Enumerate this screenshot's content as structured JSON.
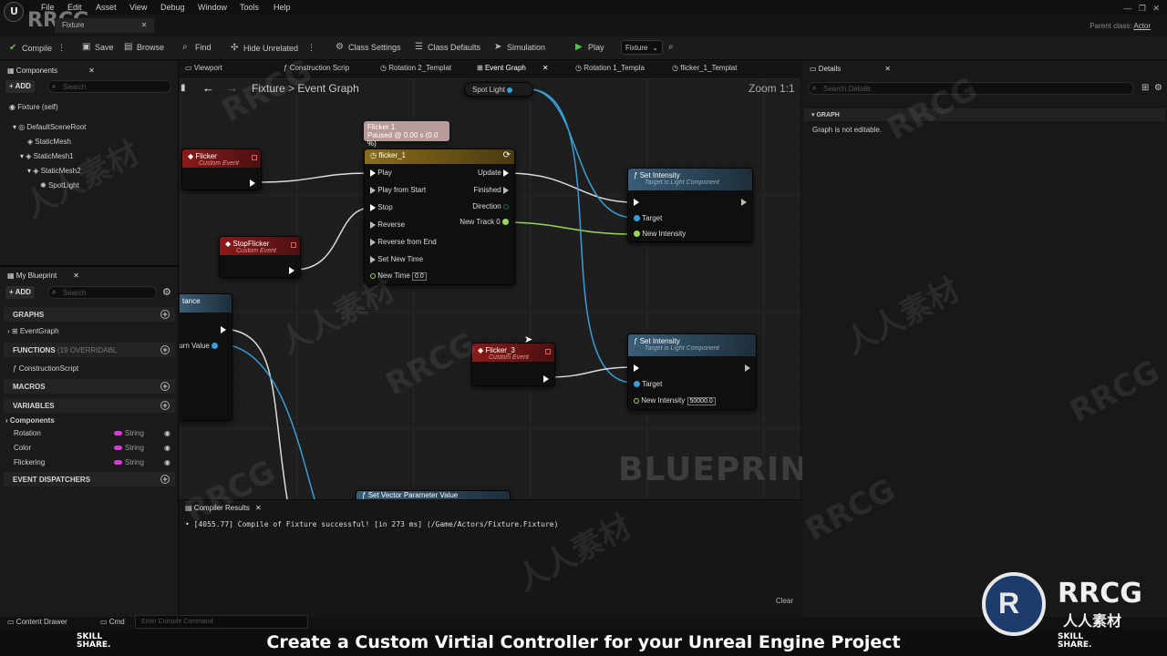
{
  "menu": [
    "File",
    "Edit",
    "Asset",
    "View",
    "Debug",
    "Window",
    "Tools",
    "Help"
  ],
  "file_tab": "Fixture",
  "parent_class_label": "Parent class:",
  "parent_class_value": "Actor",
  "toolbar": {
    "compile": "Compile",
    "save": "Save",
    "browse": "Browse",
    "find": "Find",
    "hide_unrelated": "Hide Unrelated",
    "class_settings": "Class Settings",
    "class_defaults": "Class Defaults",
    "simulation": "Simulation",
    "play": "Play",
    "debug_object": "Fixture"
  },
  "components_panel": {
    "title": "Components",
    "add": "ADD",
    "search_placeholder": "Search",
    "root": "Fixture (self)",
    "items": [
      "DefaultSceneRoot",
      "StaticMesh",
      "StaticMesh1",
      "StaticMesh2",
      "SpotLight"
    ]
  },
  "my_blueprint": {
    "title": "My Blueprint",
    "add": "ADD",
    "search_placeholder": "Search",
    "graphs_label": "GRAPHS",
    "event_graph": "EventGraph",
    "functions_label": "FUNCTIONS",
    "functions_count": "(19 OVERRIDABL",
    "construction_script": "ConstructionScript",
    "macros_label": "MACROS",
    "variables_label": "VARIABLES",
    "components_cat": "Components",
    "variables": [
      {
        "name": "Rotation",
        "type": "String"
      },
      {
        "name": "Color",
        "type": "String"
      },
      {
        "name": "Flickering",
        "type": "String"
      }
    ],
    "dispatchers_label": "EVENT DISPATCHERS"
  },
  "doc_tabs": [
    "Viewport",
    "Construction Scrip",
    "Rotation 2_Templat",
    "Event Graph",
    "Rotation 1_Templa",
    "flicker_1_Templat"
  ],
  "breadcrumb": {
    "root": "Fixture",
    "sep": ">",
    "current": "Event Graph"
  },
  "zoom": "Zoom 1:1",
  "spot_light_node": "Spot Light",
  "nodes": {
    "flicker": {
      "title": "Flicker",
      "sub": "Custom Event"
    },
    "stop_flicker": {
      "title": "StopFlicker",
      "sub": "Custom Event"
    },
    "flicker3": {
      "title": "Flicker_3",
      "sub": "Custom Event"
    },
    "distance_partial": "tance",
    "return_value_partial": "turn Value",
    "timeline": {
      "tooltip_line1": "Flicker 1",
      "tooltip_line2": "Paused @ 0.00 s (0.0 %)",
      "title": "flicker_1",
      "inputs": [
        "Play",
        "Play from Start",
        "Stop",
        "Reverse",
        "Reverse from End",
        "Set New Time",
        "New Time"
      ],
      "new_time_value": "0.0",
      "outputs": [
        "Update",
        "Finished",
        "Direction",
        "New Track 0"
      ]
    },
    "set_intensity_1": {
      "title": "Set Intensity",
      "sub": "Target is Light Component",
      "target": "Target",
      "new_intensity": "New Intensity"
    },
    "set_intensity_2": {
      "title": "Set Intensity",
      "sub": "Target is Light Component",
      "target": "Target",
      "new_intensity": "New Intensity",
      "value": "50000.0"
    },
    "set_vector_partial": "Set Vector Parameter Value"
  },
  "blueprint_watermark": "BLUEPRINT",
  "compiler": {
    "tab": "Compiler Results",
    "log": "• [4055.77] Compile of Fixture successful! [in 273 ms] (/Game/Actors/Fixture.Fixture)",
    "clear": "Clear"
  },
  "details": {
    "title": "Details",
    "search_placeholder": "Search Details",
    "section": "GRAPH",
    "message": "Graph is not editable."
  },
  "status": {
    "content_drawer": "Content Drawer",
    "cmd": "Cmd",
    "console_placeholder": "Enter Console Command"
  },
  "banner": {
    "title": "Create a Custom Virtial Controller for your Unreal Engine Project",
    "skill1": "SKILL",
    "skill2": "SHARE."
  },
  "watermark": {
    "rrcg": "RRCG",
    "rrcg_cn": "人人素材",
    "rrcg_logo": "R"
  },
  "colors": {
    "exec": "#ffffff",
    "object_pin": "#3a9dd6",
    "float_pin": "#9ad65a",
    "string_pin": "#d63ad6",
    "event_header": "#8c1a1a",
    "function_header": "#3a5e78",
    "timeline_header": "#8a6d1a"
  }
}
